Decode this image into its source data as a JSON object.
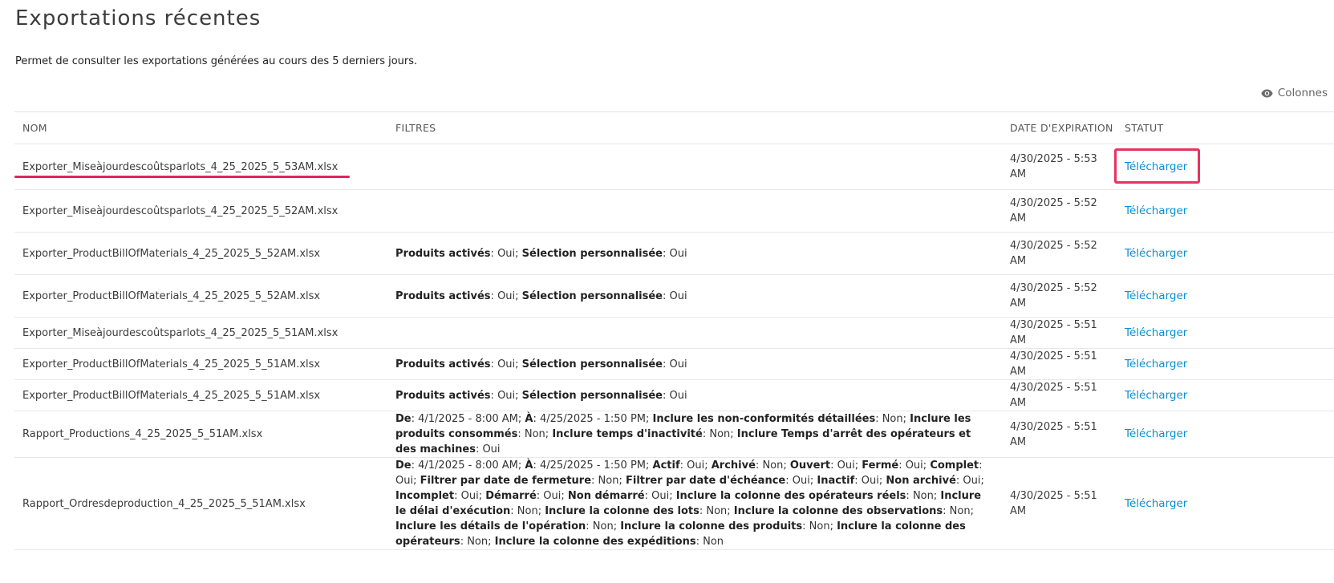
{
  "page": {
    "title": "Exportations récentes",
    "subtitle": "Permet de consulter les exportations générées au cours des 5 derniers jours."
  },
  "toolbar": {
    "columns_label": "Colonnes",
    "columns_icon": "eye-icon"
  },
  "table": {
    "headers": {
      "name": "NOM",
      "filters": "FILTRES",
      "expiration": "DATE D'EXPIRATION",
      "status": "STATUT"
    },
    "rows": [
      {
        "name": "Exporter_Miseàjourdescoûtsparlots_4_25_2025_5_53AM.xlsx",
        "filters": [],
        "expiration": "4/30/2025 - 5:53 AM",
        "status": "Télécharger"
      },
      {
        "name": "Exporter_Miseàjourdescoûtsparlots_4_25_2025_5_52AM.xlsx",
        "filters": [],
        "expiration": "4/30/2025 - 5:52 AM",
        "status": "Télécharger"
      },
      {
        "name": "Exporter_ProductBillOfMaterials_4_25_2025_5_52AM.xlsx",
        "filters": [
          [
            "Produits activés",
            "Oui"
          ],
          [
            "Sélection personnalisée",
            "Oui"
          ]
        ],
        "expiration": "4/30/2025 - 5:52 AM",
        "status": "Télécharger"
      },
      {
        "name": "Exporter_ProductBillOfMaterials_4_25_2025_5_52AM.xlsx",
        "filters": [
          [
            "Produits activés",
            "Oui"
          ],
          [
            "Sélection personnalisée",
            "Oui"
          ]
        ],
        "expiration": "4/30/2025 - 5:52 AM",
        "status": "Télécharger"
      },
      {
        "name": "Exporter_Miseàjourdescoûtsparlots_4_25_2025_5_51AM.xlsx",
        "filters": [],
        "expiration": "4/30/2025 - 5:51 AM",
        "status": "Télécharger"
      },
      {
        "name": "Exporter_ProductBillOfMaterials_4_25_2025_5_51AM.xlsx",
        "filters": [
          [
            "Produits activés",
            "Oui"
          ],
          [
            "Sélection personnalisée",
            "Oui"
          ]
        ],
        "expiration": "4/30/2025 - 5:51 AM",
        "status": "Télécharger"
      },
      {
        "name": "Exporter_ProductBillOfMaterials_4_25_2025_5_51AM.xlsx",
        "filters": [
          [
            "Produits activés",
            "Oui"
          ],
          [
            "Sélection personnalisée",
            "Oui"
          ]
        ],
        "expiration": "4/30/2025 - 5:51 AM",
        "status": "Télécharger"
      },
      {
        "name": "Rapport_Productions_4_25_2025_5_51AM.xlsx",
        "filters": [
          [
            "De",
            "4/1/2025 - 8:00 AM"
          ],
          [
            "À",
            "4/25/2025 - 1:50 PM"
          ],
          [
            "Inclure les non-conformités détaillées",
            "Non"
          ],
          [
            "Inclure les produits consommés",
            "Non"
          ],
          [
            "Inclure temps d'inactivité",
            "Non"
          ],
          [
            "Inclure Temps d'arrêt des opérateurs et des machines",
            "Oui"
          ]
        ],
        "expiration": "4/30/2025 - 5:51 AM",
        "status": "Télécharger"
      },
      {
        "name": "Rapport_Ordresdeproduction_4_25_2025_5_51AM.xlsx",
        "filters": [
          [
            "De",
            "4/1/2025 - 8:00 AM"
          ],
          [
            "À",
            "4/25/2025 - 1:50 PM"
          ],
          [
            "Actif",
            "Oui"
          ],
          [
            "Archivé",
            "Non"
          ],
          [
            "Ouvert",
            "Oui"
          ],
          [
            "Fermé",
            "Oui"
          ],
          [
            "Complet",
            "Oui"
          ],
          [
            "Filtrer par date de fermeture",
            "Non"
          ],
          [
            "Filtrer par date d'échéance",
            "Oui"
          ],
          [
            "Inactif",
            "Oui"
          ],
          [
            "Non archivé",
            "Oui"
          ],
          [
            "Incomplet",
            "Oui"
          ],
          [
            "Démarré",
            "Oui"
          ],
          [
            "Non démarré",
            "Oui"
          ],
          [
            "Inclure la colonne des opérateurs réels",
            "Non"
          ],
          [
            "Inclure le délai d'exécution",
            "Non"
          ],
          [
            "Inclure la colonne des lots",
            "Non"
          ],
          [
            "Inclure la colonne des observations",
            "Non"
          ],
          [
            "Inclure les détails de l'opération",
            "Non"
          ],
          [
            "Inclure la colonne des produits",
            "Non"
          ],
          [
            "Inclure la colonne des opérateurs",
            "Non"
          ],
          [
            "Inclure la colonne des expéditions",
            "Non"
          ]
        ],
        "expiration": "4/30/2025 - 5:51 AM",
        "status": "Télécharger"
      }
    ]
  },
  "annotations": {
    "underline_color": "#e0245e",
    "highlight_color": "#e8325f"
  },
  "colors": {
    "link": "#0a8fd4",
    "text": "#3c3c3c",
    "border": "#e4e4e4"
  }
}
